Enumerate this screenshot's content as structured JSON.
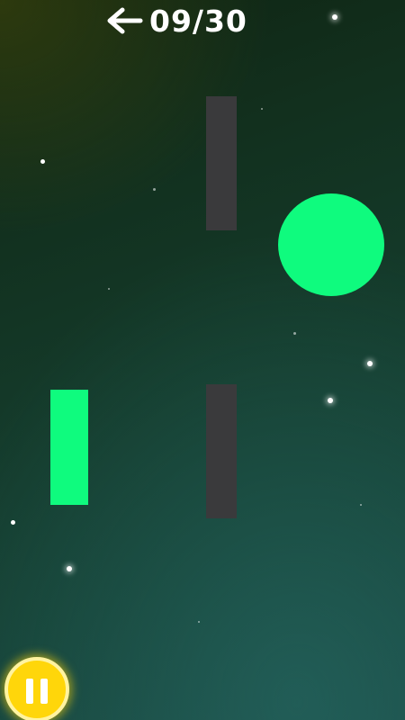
{
  "hud": {
    "current_level": "09",
    "total_levels": "30",
    "level_text": "09/30",
    "back_icon": "arrow-left-icon",
    "pause_icon": "pause-icon"
  },
  "colors": {
    "player_green": "#0ffb7e",
    "wall_gray": "#3a3a3c",
    "pause_yellow": "#ffd60a",
    "text_white": "#ffffff"
  }
}
